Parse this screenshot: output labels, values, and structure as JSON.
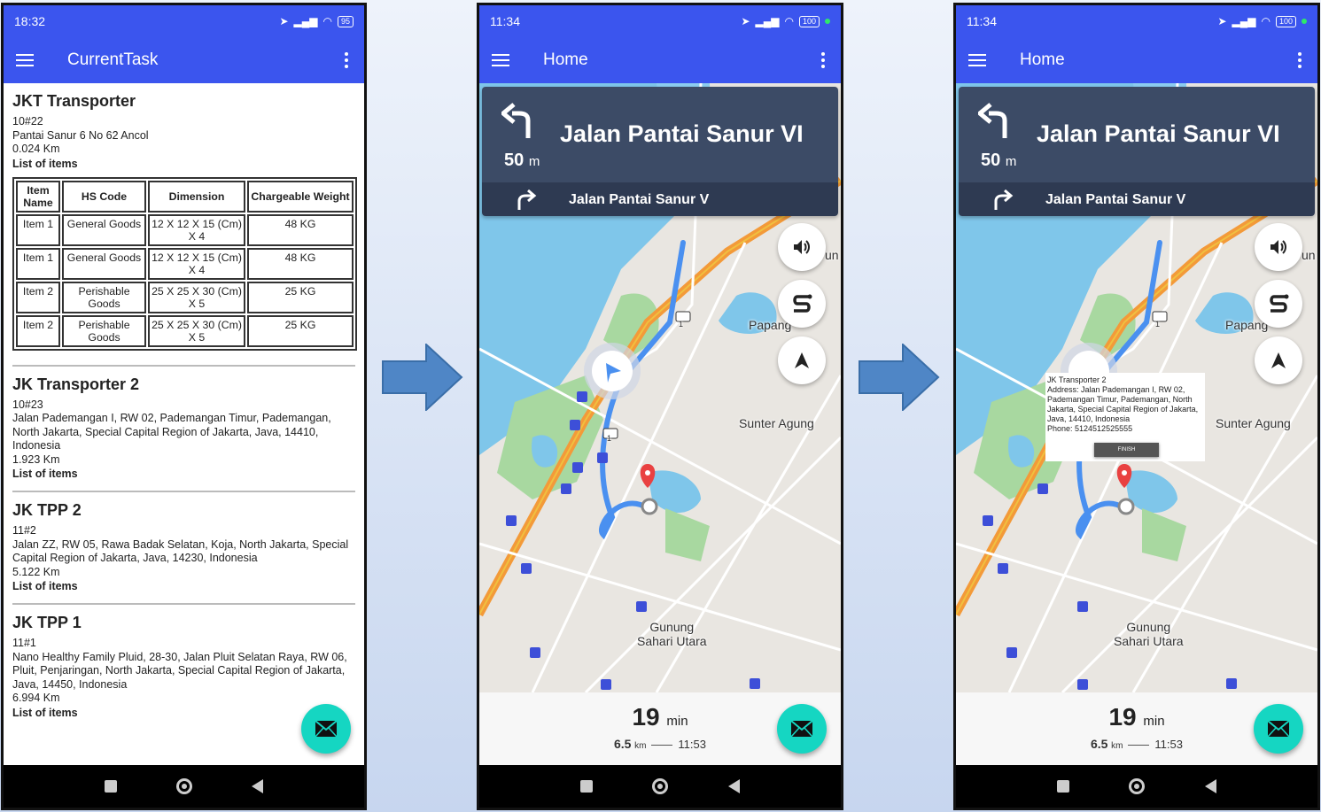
{
  "colors": {
    "appbar": "#3b55ee",
    "fab": "#15d6c2",
    "banner": "#3c4b66",
    "route": "#4a90f0"
  },
  "screen1": {
    "time": "18:32",
    "battery": "95",
    "title": "CurrentTask",
    "tasks": [
      {
        "name": "JKT Transporter",
        "code": "10#22",
        "address": "Pantai Sanur 6 No 62 Ancol",
        "distance": "0.024 Km",
        "items_label": "List of items",
        "table": {
          "headers": [
            "Item Name",
            "HS Code",
            "Dimension",
            "Chargeable Weight"
          ],
          "rows": [
            [
              "Item 1",
              "General Goods",
              "12 X 12 X 15 (Cm) X 4",
              "48 KG"
            ],
            [
              "Item 1",
              "General Goods",
              "12 X 12 X 15 (Cm) X 4",
              "48 KG"
            ],
            [
              "Item 2",
              "Perishable Goods",
              "25 X 25 X 30 (Cm) X 5",
              "25 KG"
            ],
            [
              "Item 2",
              "Perishable Goods",
              "25 X 25 X 30 (Cm) X 5",
              "25 KG"
            ]
          ]
        }
      },
      {
        "name": "JK Transporter 2",
        "code": "10#23",
        "address": "Jalan Pademangan I, RW 02, Pademangan Timur, Pademangan, North Jakarta, Special Capital Region of Jakarta, Java, 14410, Indonesia",
        "distance": "1.923 Km",
        "items_label": "List of items"
      },
      {
        "name": "JK TPP 2",
        "code": "11#2",
        "address": "Jalan ZZ, RW 05, Rawa Badak Selatan, Koja, North Jakarta, Special Capital Region of Jakarta, Java, 14230, Indonesia",
        "distance": "5.122 Km",
        "items_label": "List of items"
      },
      {
        "name": "JK TPP 1",
        "code": "11#1",
        "address": "Nano Healthy Family Pluid, 28-30, Jalan Pluit Selatan Raya, RW 06, Pluit, Penjaringan, North Jakarta, Special Capital Region of Jakarta, Java, 14450, Indonesia",
        "distance": "6.994 Km",
        "items_label": "List of items"
      }
    ]
  },
  "screen2": {
    "time": "11:34",
    "battery": "100",
    "title": "Home",
    "nav": {
      "distance": "50",
      "unit": "m",
      "street": "Jalan Pantai Sanur VI",
      "next_street": "Jalan Pantai Sanur V"
    },
    "map_labels": {
      "papango": "Papang",
      "sunter": "Sunter Agung",
      "gunung_1": "Gunung",
      "gunung_2": "Sahari Utara",
      "edge": "un",
      "road_shield": "1"
    },
    "eta": {
      "minutes": "19",
      "min_unit": "min",
      "distance": "6.5",
      "km_unit": "km",
      "arrival": "11:53"
    }
  },
  "screen3": {
    "time": "11:34",
    "battery": "100",
    "title": "Home",
    "nav": {
      "distance": "50",
      "unit": "m",
      "street": "Jalan Pantai Sanur VI",
      "next_street": "Jalan Pantai Sanur V"
    },
    "map_labels": {
      "papango": "Papang",
      "sunter": "Sunter Agung",
      "gunung_1": "Gunung",
      "gunung_2": "Sahari Utara",
      "edge": "un",
      "road_shield": "1"
    },
    "popup": {
      "title": "JK Transporter 2",
      "address": "Address: Jalan Pademangan I, RW 02, Pademangan Timur, Pademangan, North Jakarta, Special Capital Region of Jakarta, Java, 14410, Indonesia",
      "phone": "Phone: 5124512525555",
      "finish": "FINISH"
    },
    "eta": {
      "minutes": "19",
      "min_unit": "min",
      "distance": "6.5",
      "km_unit": "km",
      "arrival": "11:53"
    }
  }
}
